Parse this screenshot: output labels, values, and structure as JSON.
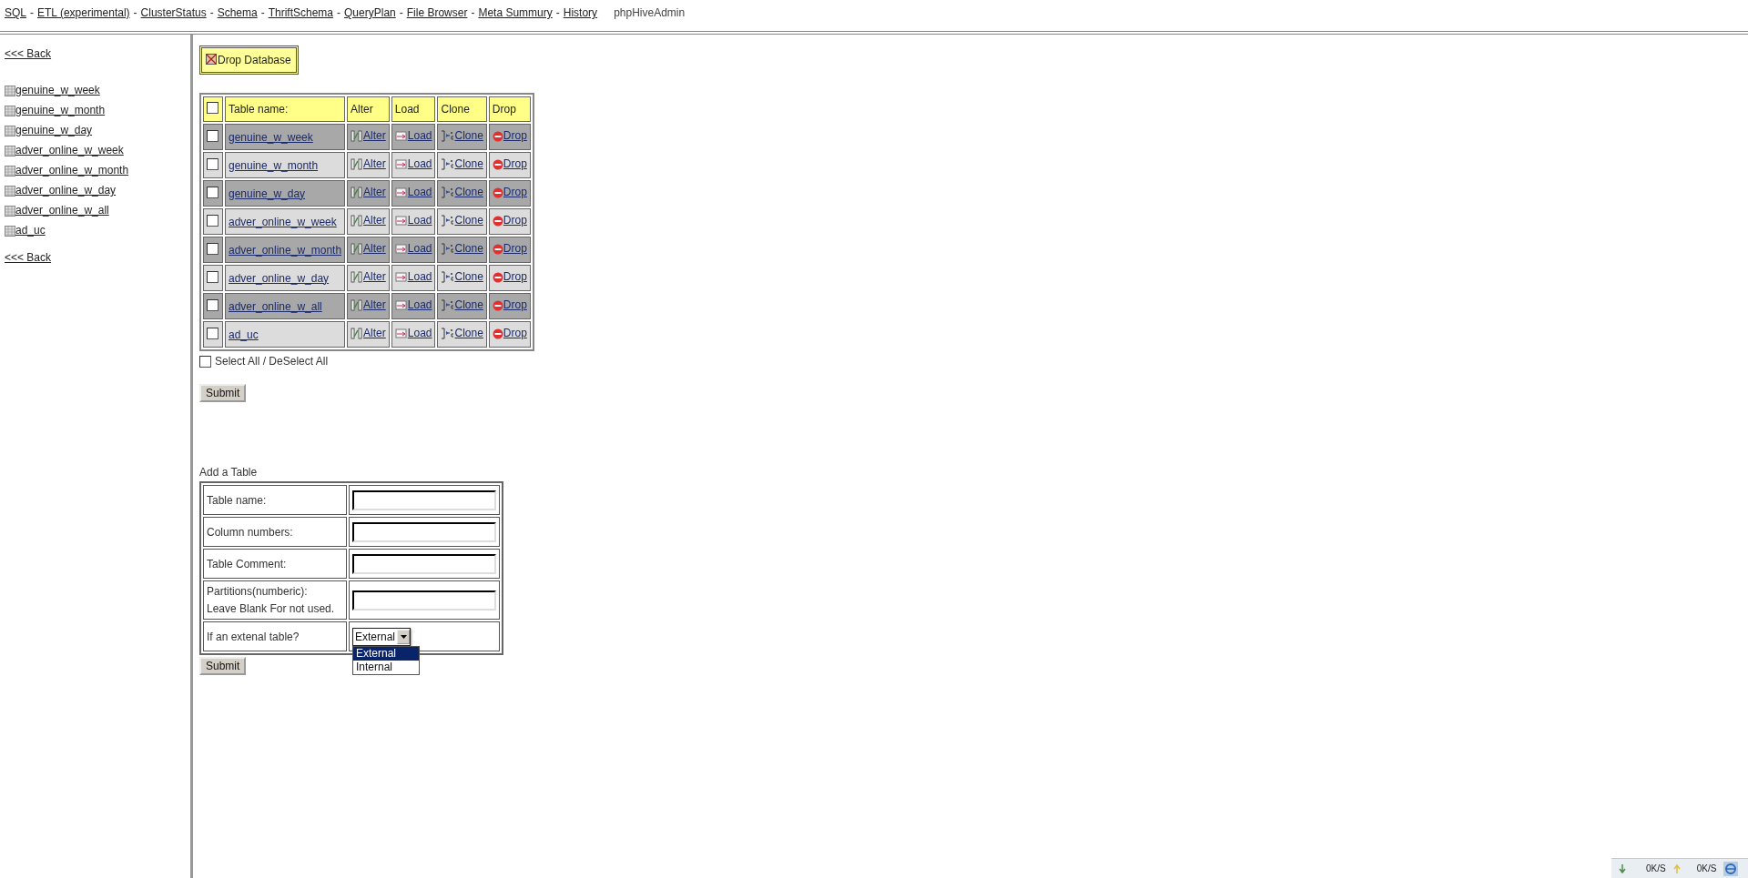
{
  "nav": {
    "links": [
      "SQL",
      "ETL (experimental)",
      "ClusterStatus",
      "Schema",
      "ThriftSchema",
      "QueryPlan",
      "File Browser",
      "Meta Summury",
      "History"
    ],
    "separator": "-",
    "brand": "phpHiveAdmin"
  },
  "sidebar": {
    "back_top": "<<< Back",
    "tables": [
      "genuine_w_week",
      "genuine_w_month",
      "genuine_w_day",
      "adver_online_w_week",
      "adver_online_w_month",
      "adver_online_w_day",
      "adver_online_w_all",
      "ad_uc"
    ],
    "back_bottom": "<<< Back"
  },
  "drop_database": "Drop Database",
  "tables_grid": {
    "header_checked": false,
    "columns": [
      "Table name:",
      "Alter",
      "Load",
      "Clone",
      "Drop"
    ],
    "rows": [
      {
        "name": "genuine_w_week",
        "checked": false,
        "alter": "Alter",
        "load": "Load",
        "clone": "Clone",
        "drop": "Drop"
      },
      {
        "name": "genuine_w_month",
        "checked": false,
        "alter": "Alter",
        "load": "Load",
        "clone": "Clone",
        "drop": "Drop"
      },
      {
        "name": "genuine_w_day",
        "checked": false,
        "alter": "Alter",
        "load": "Load",
        "clone": "Clone",
        "drop": "Drop"
      },
      {
        "name": "adver_online_w_week",
        "checked": false,
        "alter": "Alter",
        "load": "Load",
        "clone": "Clone",
        "drop": "Drop"
      },
      {
        "name": "adver_online_w_month",
        "checked": false,
        "alter": "Alter",
        "load": "Load",
        "clone": "Clone",
        "drop": "Drop"
      },
      {
        "name": "adver_online_w_day",
        "checked": false,
        "alter": "Alter",
        "load": "Load",
        "clone": "Clone",
        "drop": "Drop"
      },
      {
        "name": "adver_online_w_all",
        "checked": false,
        "alter": "Alter",
        "load": "Load",
        "clone": "Clone",
        "drop": "Drop"
      },
      {
        "name": "ad_uc",
        "checked": false,
        "alter": "Alter",
        "load": "Load",
        "clone": "Clone",
        "drop": "Drop"
      }
    ]
  },
  "select_all": {
    "label": "Select All / DeSelect All",
    "checked": false
  },
  "submit": "Submit",
  "add_table": {
    "title": "Add a Table",
    "fields": [
      {
        "kind": "text",
        "label": "Table name:"
      },
      {
        "kind": "text",
        "label": "Column numbers:"
      },
      {
        "kind": "text",
        "label": "Table Comment:"
      },
      {
        "kind": "text",
        "label": "Partitions(numberic):",
        "note": "Leave Blank For not used."
      },
      {
        "kind": "select",
        "label": "If an extenal table?",
        "value": "External",
        "expanded": true,
        "options": [
          {
            "label": "External",
            "selected": true
          },
          {
            "label": "Internal",
            "selected": false
          }
        ]
      }
    ],
    "submit": "Submit"
  },
  "status_bar": {
    "download": "0K/S",
    "upload": "0K/S"
  }
}
